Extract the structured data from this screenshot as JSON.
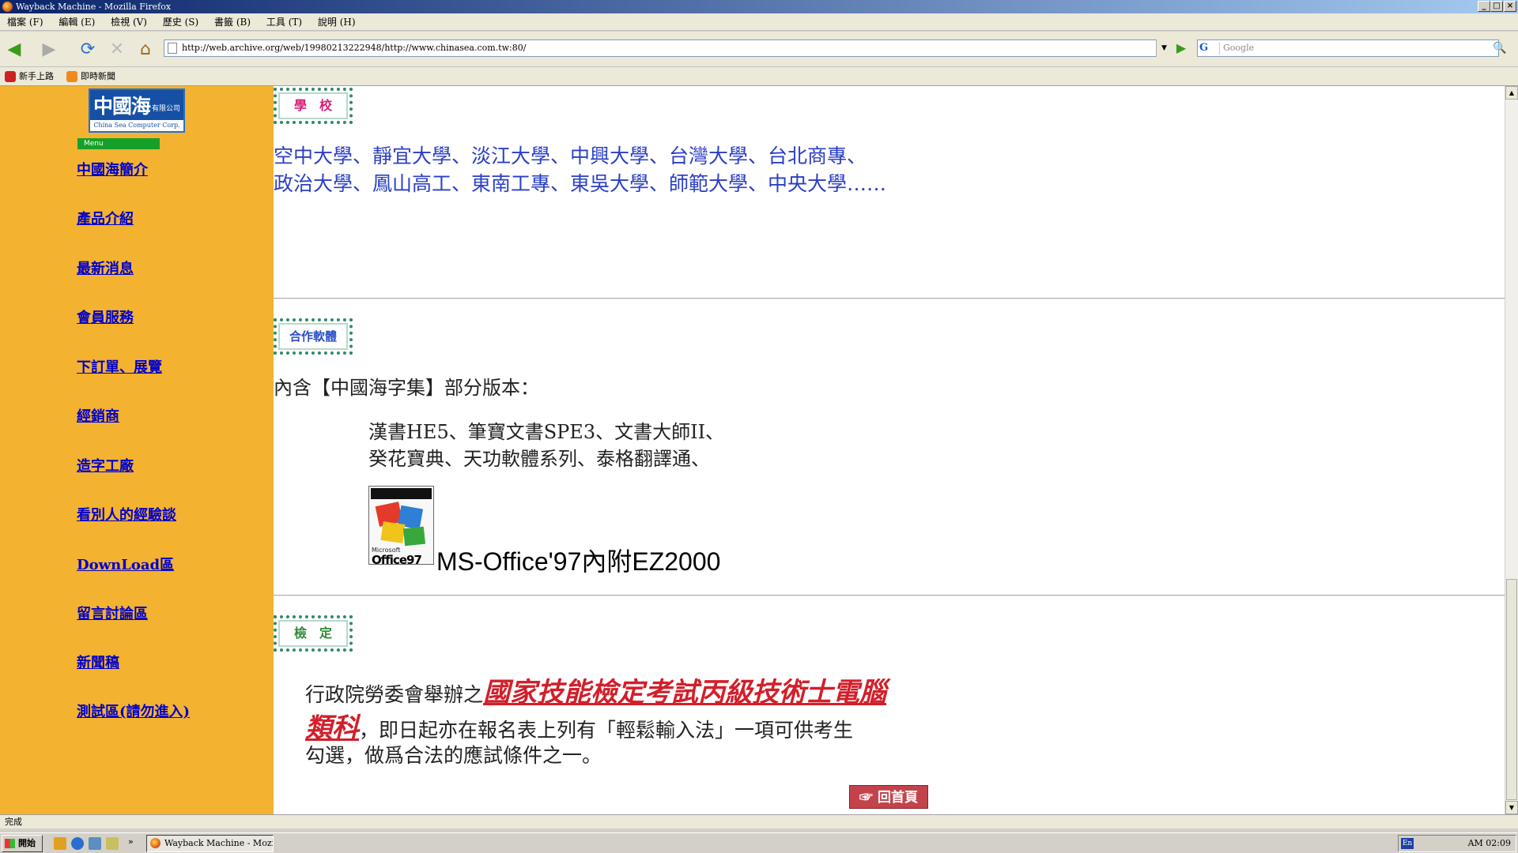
{
  "window": {
    "title": "Wayback Machine - Mozilla Firefox",
    "controls": [
      "_",
      "□",
      "×"
    ]
  },
  "menu": [
    "檔案 (F)",
    "編輯 (E)",
    "檢視 (V)",
    "歷史 (S)",
    "書籤 (B)",
    "工具 (T)",
    "說明 (H)"
  ],
  "toolbar": {
    "url": "http://web.archive.org/web/19980213222948/http://www.chinasea.com.tw:80/",
    "search_placeholder": "Google",
    "search_engine": "G",
    "back_icon": "◀",
    "forward_icon": "▶",
    "reload_icon": "⟳",
    "stop_icon": "✕",
    "home_icon": "⌂",
    "go_icon": "▶",
    "search_icon": "🔍",
    "dropdown_icon": "▼"
  },
  "bookmarks": [
    {
      "label": "新手上路"
    },
    {
      "label": "即時新聞"
    }
  ],
  "sidebar": {
    "logo_big": "中國海",
    "logo_small": "有限公司",
    "logo_sub": "China Sea Computer Corp.",
    "menu_tag": "Menu",
    "items": [
      "中國海簡介",
      "產品介紹",
      "最新消息",
      "會員服務",
      "下訂單、展覽",
      "經銷商",
      "造字工廠",
      "看別人的經驗談",
      "DownLoad區",
      "留言討論區",
      "新聞稿",
      "測試區(請勿進入)"
    ]
  },
  "main": {
    "badge_school": "學　校",
    "schools_line1": "空中大學、靜宜大學、淡江大學、中興大學、台灣大學、台北商專、",
    "schools_line2": "政治大學、鳳山高工、東南工專、東吳大學、師範大學、中央大學……",
    "badge_software": "合作軟體",
    "software_intro": "內含【中國海字集】部分版本：",
    "software_line1": "漢書HE5、筆寶文書SPE3、文書大師II、",
    "software_line2": "癸花寶典、天功軟體系列、泰格翻譯通、",
    "office_box_small": "Microsoft",
    "office_box_big": "Office97",
    "office_caption": "MS-Office'97內附EZ2000",
    "badge_cert": "檢　定",
    "cert_prefix": "行政院勞委會舉辦之",
    "cert_link1": "國家技能檢定考試丙級技術士電腦",
    "cert_link2": "類科",
    "cert_line2_rest": "，即日起亦在報名表上列有「輕鬆輸入法」一項可供考生",
    "cert_line3": "勾選，做爲合法的應試條件之一。",
    "home_button": "☞ 回首頁"
  },
  "status": {
    "text": "完成"
  },
  "taskbar": {
    "start": "開始",
    "task": "Wayback Machine - Mozill...",
    "tray_lang": "En",
    "clock": "AM 02:09",
    "more": "»"
  },
  "colors": {
    "sidebar": "#f3b22f",
    "link": "#0000cc",
    "school_text": "#2b3fc6",
    "red_link": "#d21f2a",
    "badge_border": "#2f8a6b",
    "home_button": "#c4434b"
  }
}
